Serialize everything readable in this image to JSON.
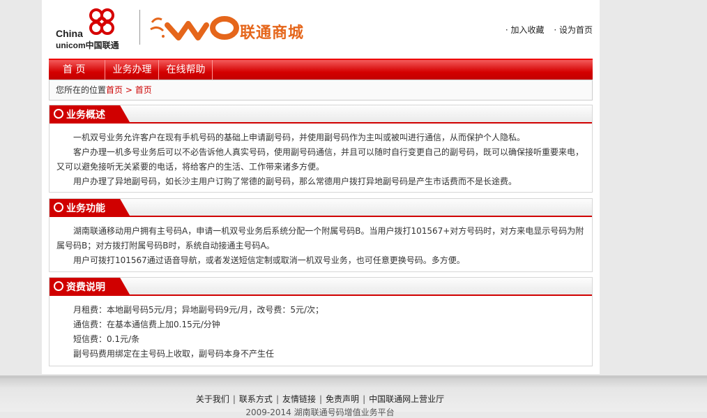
{
  "header": {
    "logo_china": "China",
    "logo_unicom": "unicom中国联通",
    "mall_title": "联通商城",
    "links": [
      "· 加入收藏",
      "· 设为首页"
    ]
  },
  "nav": {
    "items": [
      "首 页",
      "业务办理",
      "在线帮助"
    ]
  },
  "breadcrumb": {
    "lead": "您所在的位置",
    "current": "首页",
    "trail": "> 首页"
  },
  "sections": [
    {
      "title": "业务概述",
      "paragraphs": [
        "一机双号业务允许客户在现有手机号码的基础上申请副号码，并使用副号码作为主叫或被叫进行通信，从而保护个人隐私。",
        "客户办理一机多号业务后可以不必告诉他人真实号码，使用副号码通信，并且可以随时自行变更自己的副号码，既可以确保接听重要来电，又可以避免接听无关紧要的电话，将给客户的生活、工作带来诸多方便。",
        "用户办理了异地副号码，如长沙主用户订购了常德的副号码，那么常德用户拨打异地副号码是产生市话费而不是长途费。"
      ]
    },
    {
      "title": "业务功能",
      "paragraphs": [
        "湖南联通移动用户拥有主号码A，申请一机双号业务后系统分配一个附属号码B。当用户拨打101567+对方号码时，对方来电显示号码为附属号码B；对方拨打附属号码B时，系统自动接通主号码A。",
        "用户可拨打101567通过语音导航，或者发送短信定制或取消一机双号业务，也可任意更换号码。多方便。"
      ]
    },
    {
      "title": "资费说明",
      "paragraphs": [
        "月租费：本地副号码5元/月；异地副号码9元/月，改号费：5元/次；",
        "通信费：在基本通信费上加0.15元/分钟",
        "短信费：0.1元/条",
        "副号码费用绑定在主号码上收取，副号码本身不产生任"
      ]
    }
  ],
  "footer": {
    "links": [
      "关于我们",
      "联系方式",
      "友情链接",
      "免责声明",
      "中国联通网上营业厅"
    ],
    "separator": "|",
    "copyright": "2009-2014 湖南联通号码增值业务平台"
  },
  "colors": {
    "brand_red": "#d00000",
    "wo_orange": "#e5661b",
    "page_bg": "#e9e9e9"
  }
}
